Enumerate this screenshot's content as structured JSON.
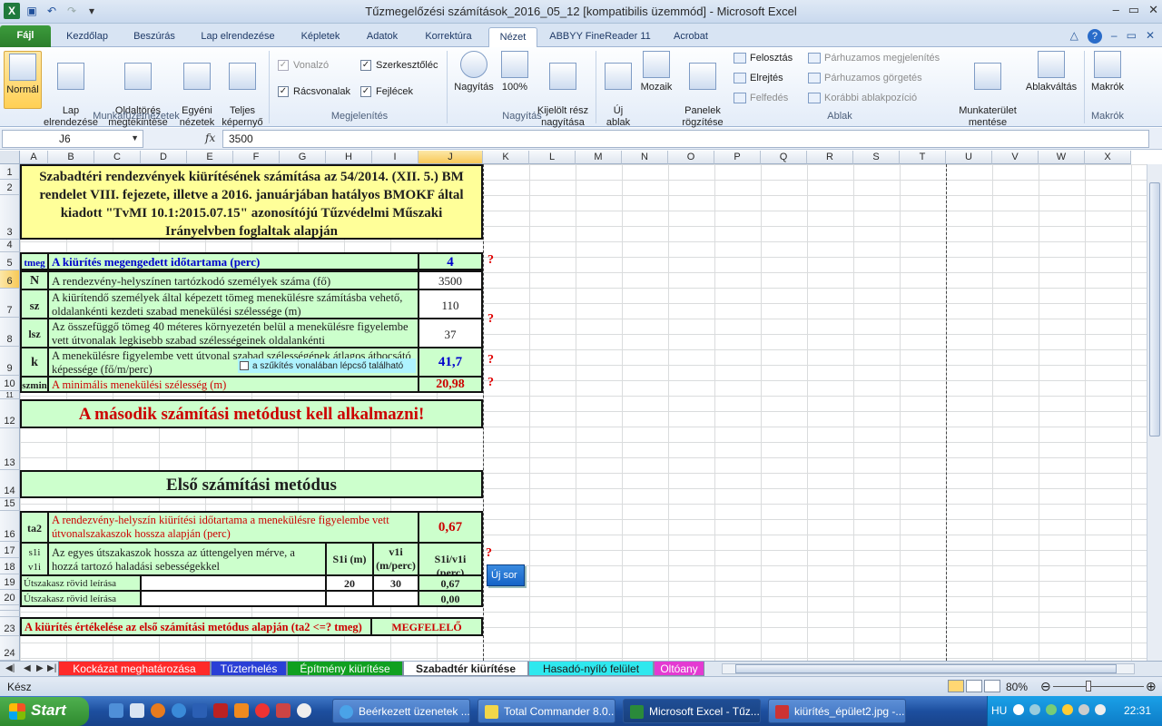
{
  "window": {
    "title": "Tűzmegelőzési számítások_2016_05_12  [kompatibilis üzemmód]  -  Microsoft Excel"
  },
  "ribbon_tabs": [
    "Fájl",
    "Kezdőlap",
    "Beszúrás",
    "Lap elrendezése",
    "Képletek",
    "Adatok",
    "Korrektúra",
    "Nézet",
    "ABBYY FineReader 11",
    "Acrobat"
  ],
  "ribbon": {
    "views": {
      "normal": "Normál",
      "page_layout": "Lap\nelrendezése",
      "page_break": "Oldaltörés\nmegtekintése",
      "custom": "Egyéni\nnézetek",
      "full": "Teljes\nképernyő",
      "group": "Munkafüzetnézetek"
    },
    "show": {
      "ruler": "Vonalzó",
      "gridlines": "Rácsvonalak",
      "formula_bar": "Szerkesztőléc",
      "headings": "Fejlécek",
      "group": "Megjelenítés"
    },
    "zoom": {
      "zoom": "Nagyítás",
      "hundred": "100%",
      "selection": "Kijelölt rész\nnagyítása",
      "group": "Nagyítás"
    },
    "window": {
      "new": "Új\nablak",
      "arrange": "Mozaik",
      "freeze": "Panelek\nrögzítése",
      "split": "Felosztás",
      "hide": "Elrejtés",
      "unhide": "Felfedés",
      "side_by_side": "Párhuzamos megjelenítés",
      "sync_scroll": "Párhuzamos görgetés",
      "reset_pos": "Korábbi ablakpozíció",
      "save_ws": "Munkaterület\nmentése",
      "switch": "Ablakváltás",
      "group": "Ablak"
    },
    "macros": {
      "macros": "Makrók",
      "group": "Makrók"
    }
  },
  "formula_bar": {
    "name_box": "J6",
    "fx": "fx",
    "formula": "3500"
  },
  "columns": [
    "A",
    "B",
    "C",
    "D",
    "E",
    "F",
    "G",
    "H",
    "I",
    "J",
    "K",
    "L",
    "M",
    "N",
    "O",
    "P",
    "Q",
    "R",
    "S",
    "T",
    "U",
    "V",
    "W",
    "X"
  ],
  "sheet": {
    "header_text": "Szabadtéri rendezvények kiürítésének számítása az 54/2014. (XII. 5.) BM rendelet VIII. fejezete, illetve a 2016. januárjában hatályos BMOKF által kiadott \"TvMI 10.1:2015.07.15\" azonosítójú Tűzvédelmi Műszaki Irányelvben foglaltak alapján",
    "r5": {
      "sym": "tmeg",
      "label": "A kiürítés megengedett időtartama (perc)",
      "value": "4"
    },
    "r6": {
      "sym": "N",
      "label": "A rendezvény-helyszínen tartózkodó személyek száma (fő)",
      "value": "3500"
    },
    "r7": {
      "sym": "sz",
      "label": "A kiürítendő személyek által képezett tömeg menekülésre számításba vehető, oldalankénti kezdeti szabad menekülési szélessége (m)",
      "value": "110"
    },
    "r8": {
      "sym": "lsz",
      "label": "Az összefüggő tömeg 40 méteres környezetén belül a menekülésre figyelembe vett útvonalak legkisebb szabad szélességeinek oldalankénti",
      "value": "37"
    },
    "r9": {
      "sym": "k",
      "label": "A menekülésre figyelembe vett útvonal szabad szélességének átlagos átbocsátó képessége (fő/m/perc)",
      "value": "41,7",
      "checkbox": "a szűkítés vonalában lépcső található"
    },
    "r10": {
      "sym": "szmin",
      "label": "A minimális menekülési szélesség (m)",
      "value": "20,98"
    },
    "r12": "A második számítási metódust kell alkalmazni!",
    "r14": "Első számítási metódus",
    "r16": {
      "sym": "ta2",
      "label": "A rendezvény-helyszín kiürítési időtartama a menekülésre figyelembe vett útvonalszakaszok hossza alapján (perc)",
      "value": "0,67"
    },
    "r17": {
      "sym": "s1i v1i",
      "label": "Az egyes útszakaszok hossza az úttengelyen mérve, a hozzá tartozó haladási sebességekkel",
      "h": "S1i (m)",
      "i": "v1i (m/perc)",
      "j": "S1i/v1i (perc)"
    },
    "r19": {
      "label": "Útszakasz rövid leírása",
      "h": "20",
      "i": "30",
      "j": "0,67"
    },
    "r20": {
      "label": "Útszakasz rövid leírása",
      "j": "0,00"
    },
    "r23": {
      "label": "A kiürítés értékelése az első számítási metódus alapján (ta2 <=? tmeg)",
      "value": "MEGFELELŐ"
    },
    "qmark": "?",
    "new_row_btn": "Új sor"
  },
  "sheet_tabs": [
    "Kockázat meghatározása",
    "Tűzterhelés",
    "Építmény kiürítése",
    "Szabadtér kiürítése",
    "Hasadó-nyíló felület",
    "Oltóany"
  ],
  "status": {
    "ready": "Kész",
    "zoom": "80%"
  },
  "taskbar": {
    "start": "Start",
    "tasks": [
      "Beérkezett üzenetek ...",
      "Total Commander 8.0...",
      "Microsoft Excel - Tűz...",
      "kiürítés_épület2.jpg -..."
    ],
    "lang": "HU",
    "clock": "22:31"
  },
  "colors": {
    "green_fill": "#ccffcc",
    "yellow_fill": "#ffff99",
    "red": "#cc0000",
    "blue": "#0000cc"
  }
}
